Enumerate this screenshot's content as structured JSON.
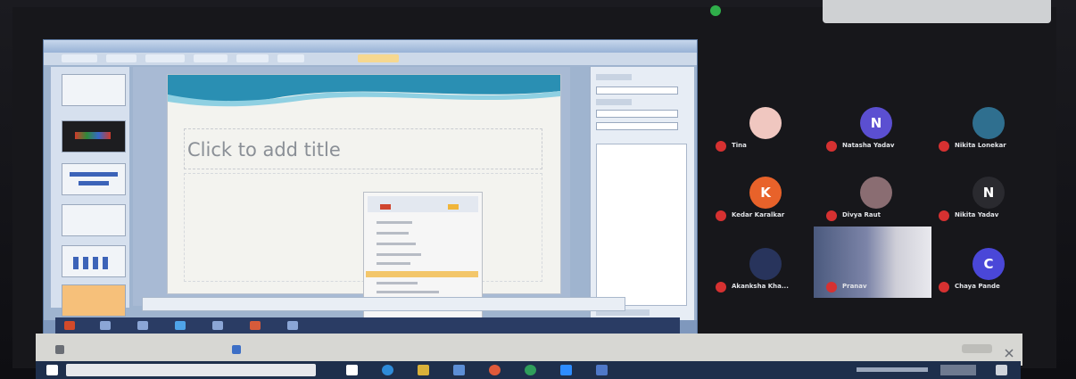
{
  "slide": {
    "title_placeholder": "Click to add title"
  },
  "participants": [
    {
      "initial": "",
      "name": "Tina",
      "color": "#f0c7c0",
      "kind": "photo"
    },
    {
      "initial": "N",
      "name": "Natasha Yadav",
      "color": "#5b4fd1",
      "kind": "letter"
    },
    {
      "initial": "",
      "name": "Nikita Lonekar",
      "color": "#2f6f8f",
      "kind": "photo"
    },
    {
      "initial": "K",
      "name": "Kedar Karalkar",
      "color": "#e8622a",
      "kind": "letter"
    },
    {
      "initial": "",
      "name": "Divya Raut",
      "color": "#8a6d72",
      "kind": "photo"
    },
    {
      "initial": "N",
      "name": "Nikita Yadav",
      "color": "#2a2a2f",
      "kind": "letter"
    },
    {
      "initial": "",
      "name": "Akanksha Kha...",
      "color": "#28345c",
      "kind": "photo"
    },
    {
      "initial": "",
      "name": "Pranav",
      "color": "#5b6f98",
      "kind": "video"
    },
    {
      "initial": "C",
      "name": "Chaya Pande",
      "color": "#4a47d8",
      "kind": "letter"
    }
  ],
  "colors": {
    "mic_muted": "#d63131",
    "speaking": "#2fae4a"
  }
}
